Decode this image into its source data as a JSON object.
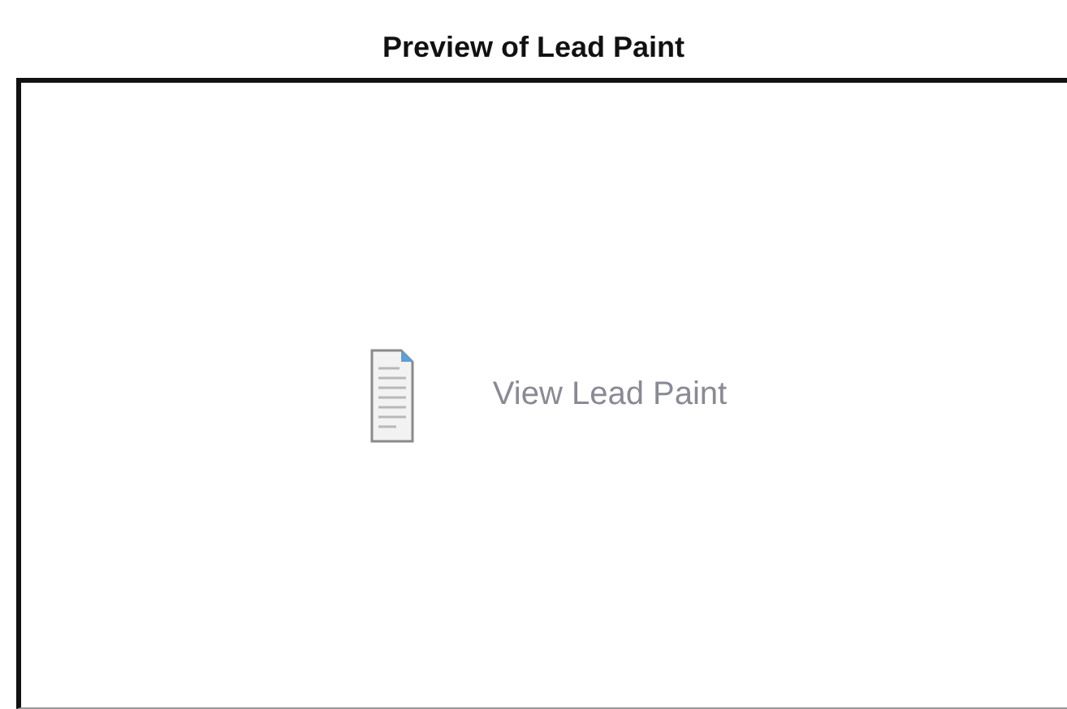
{
  "title": "Preview of Lead Paint",
  "preview": {
    "link": "View Lead Paint"
  }
}
